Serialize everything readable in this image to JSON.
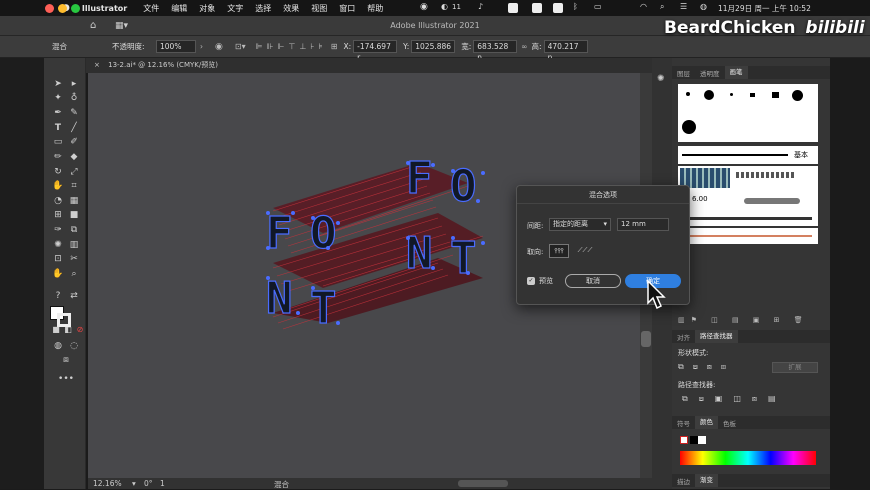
{
  "menubar": {
    "app": "Illustrator",
    "items": [
      "文件",
      "编辑",
      "对象",
      "文字",
      "选择",
      "效果",
      "视图",
      "窗口",
      "帮助"
    ],
    "clock": "11月29日 周一 上午 10:52",
    "msg_count": "11"
  },
  "window": {
    "title": "Adobe Illustrator 2021"
  },
  "control": {
    "mode": "混合",
    "opacity_label": "不透明度:",
    "opacity": "100%",
    "x_label": "X:",
    "x": "-174.697 r",
    "y_label": "Y:",
    "y": "1025.886",
    "w_label": "宽:",
    "w": "683.528 n",
    "h_label": "高:",
    "h": "470.217 n"
  },
  "doc": {
    "tab": "13-2.ai* @ 12.16% (CMYK/预览)",
    "close": "×"
  },
  "artwork": {
    "word1": "FONT",
    "word2": "FONT",
    "accent": "#c8323c",
    "anchor_color": "#4a6cff"
  },
  "status": {
    "zoom": "12.16%",
    "rotation": "0°",
    "page": "1",
    "label": "混合"
  },
  "panels": {
    "top_tabs": [
      "图层",
      "透明度",
      "画笔"
    ],
    "brush_label_basic": "基本",
    "brush_size": "6.00",
    "mid_tabs": [
      "对齐",
      "路径查找器"
    ],
    "shape_modes": "形状模式:",
    "expand": "扩展",
    "pathfinders": "路径查找器:",
    "color_tabs": [
      "符号",
      "颜色",
      "色板"
    ],
    "bottom_tabs": [
      "描边",
      "渐变"
    ]
  },
  "dialog": {
    "title": "混合选项",
    "spacing_label": "间距:",
    "spacing_mode": "指定的距离",
    "spacing_value": "12 mm",
    "orient_label": "取向:",
    "preview": "预览",
    "cancel": "取消",
    "ok": "确定"
  },
  "watermark": {
    "text": "BeardChicken",
    "logo": "bilibili"
  }
}
